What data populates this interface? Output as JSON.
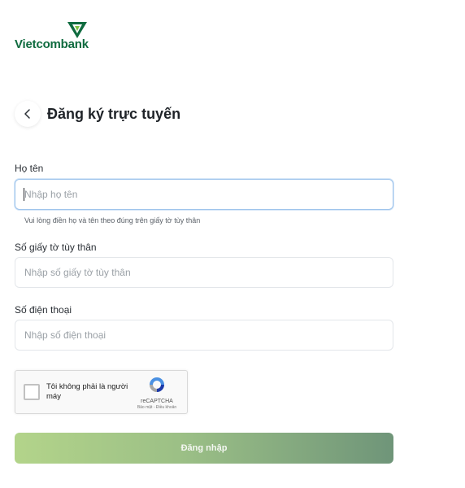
{
  "brand": {
    "name": "Vietcombank",
    "color": "#0f6b3f"
  },
  "header": {
    "title": "Đăng ký trực tuyến",
    "back_icon": "chevron-left-icon"
  },
  "form": {
    "full_name": {
      "label": "Họ tên",
      "placeholder": "Nhập họ tên",
      "value": "",
      "hint": "Vui lòng điền họ và tên theo đúng trên giấy tờ tùy thân"
    },
    "id_number": {
      "label": "Số giấy tờ tùy thân",
      "placeholder": "Nhập số giấy tờ tùy thân",
      "value": ""
    },
    "phone": {
      "label": "Số điện thoại",
      "placeholder": "Nhập số điện thoại",
      "value": ""
    }
  },
  "captcha": {
    "label": "Tôi không phải là người máy",
    "brand": "reCAPTCHA",
    "terms": "Bảo mật - Điều khoản",
    "checked": false
  },
  "submit": {
    "label": "Đăng nhập",
    "gradient": [
      "#b3d48a",
      "#6f9579"
    ]
  }
}
